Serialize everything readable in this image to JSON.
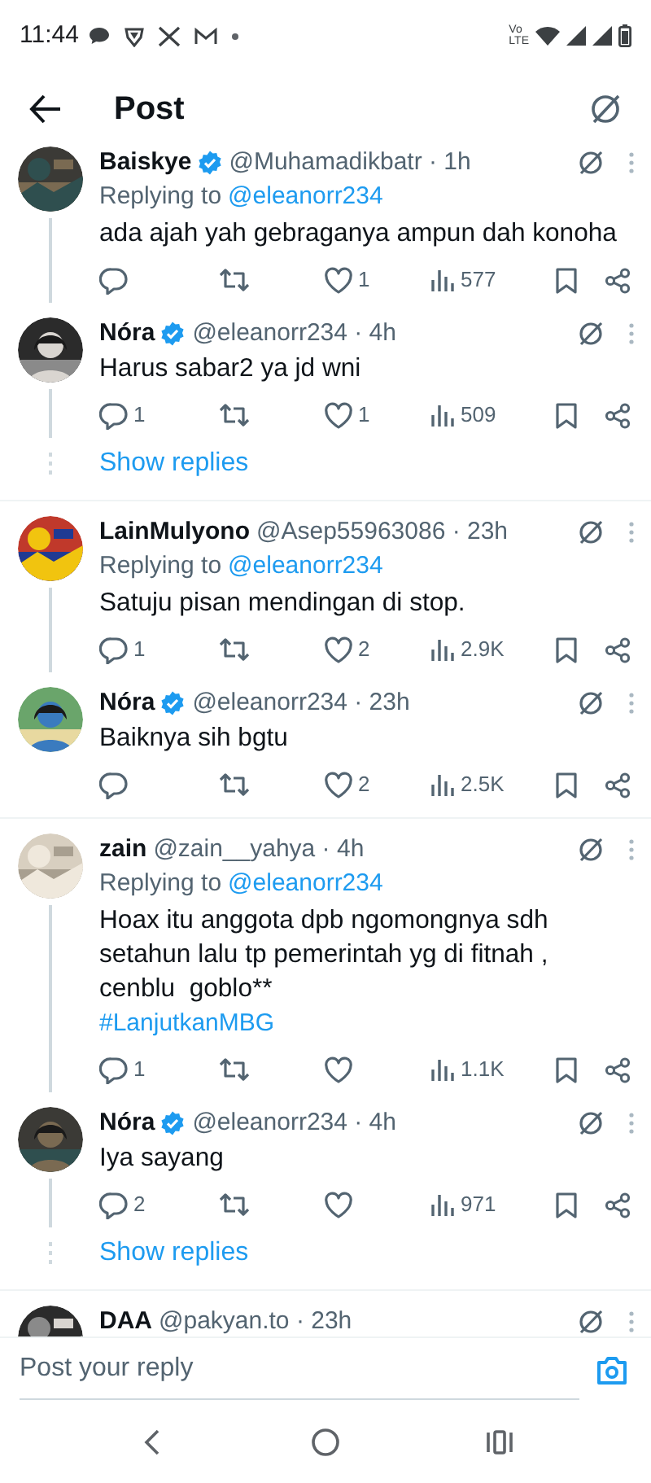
{
  "status_bar": {
    "time": "11:44",
    "volte_top": "Vo",
    "volte_bottom": "LTE"
  },
  "header": {
    "title": "Post"
  },
  "threads": [
    {
      "posts": [
        {
          "name": "Baiskye",
          "verified": true,
          "handle": "@Muhamadikbatr · 1h",
          "replying_label": "Replying to",
          "replying_handle": "@eleanorr234",
          "text": "ada ajah yah gebraganya ampun dah konoha",
          "likes": "1",
          "views": "577"
        },
        {
          "name": "Nóra",
          "verified": true,
          "handle": "@eleanorr234 · 4h",
          "text": "Harus sabar2 ya jd wni",
          "replies": "1",
          "likes": "1",
          "views": "509"
        }
      ],
      "show_replies": "Show replies"
    },
    {
      "posts": [
        {
          "name": "LainMulyono",
          "verified": false,
          "handle": "@Asep55963086 · 23h",
          "replying_label": "Replying to",
          "replying_handle": "@eleanorr234",
          "text": "Satuju pisan mendingan di stop.",
          "replies": "1",
          "likes": "2",
          "views": "2.9K"
        },
        {
          "name": "Nóra",
          "verified": true,
          "handle": "@eleanorr234 · 23h",
          "text": "Baiknya sih bgtu",
          "likes": "2",
          "views": "2.5K"
        }
      ]
    },
    {
      "posts": [
        {
          "name": "zain",
          "verified": false,
          "handle": "@zain__yahya · 4h",
          "replying_label": "Replying to",
          "replying_handle": "@eleanorr234",
          "text": "Hoax itu anggota dpb ngomongnya sdh setahun lalu tp pemerintah yg di fitnah , cenblu  goblo**",
          "hashtag": "#LanjutkanMBG",
          "replies": "1",
          "views": "1.1K"
        },
        {
          "name": "Nóra",
          "verified": true,
          "handle": "@eleanorr234 · 4h",
          "text": "Iya sayang",
          "replies": "2",
          "views": "971"
        }
      ],
      "show_replies": "Show replies"
    },
    {
      "posts": [
        {
          "name": "DAA",
          "verified": false,
          "handle": "@pakyan.to · 23h"
        }
      ]
    }
  ],
  "reply_bar": {
    "placeholder": "Post your reply"
  }
}
